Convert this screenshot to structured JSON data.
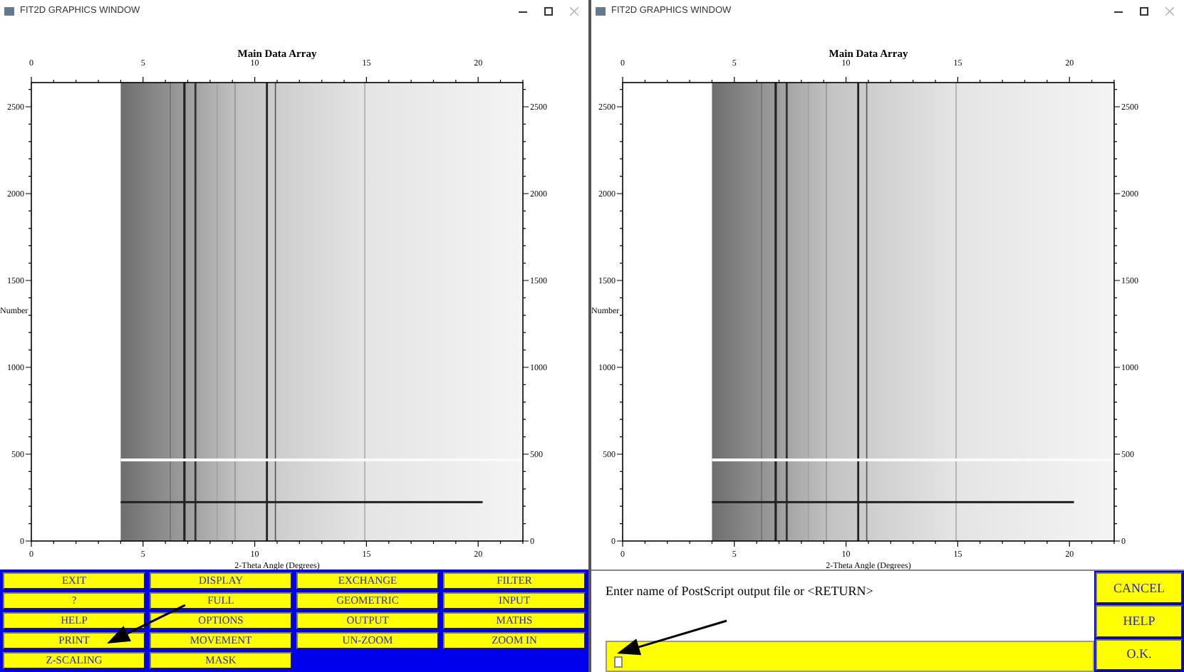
{
  "windows": [
    {
      "title": "FIT2D GRAPHICS WINDOW",
      "plot": {
        "title": "Main Data Array",
        "top_xticks": [
          "0",
          "5",
          "10",
          "15",
          "20"
        ],
        "left_yticks": [
          "2500",
          "2000",
          "1500",
          "1000",
          "500",
          "0"
        ],
        "right_yticks": [
          "2500",
          "2000",
          "1500",
          "1000",
          "500",
          "0"
        ],
        "ylabel": "Number",
        "bottom_xticks": [
          "0",
          "5",
          "10",
          "15",
          "20"
        ],
        "xlabel": "2-Theta Angle (Degrees)"
      },
      "panel": {
        "kind": "menu",
        "buttons": [
          "EXIT",
          "DISPLAY",
          "EXCHANGE",
          "FILTER",
          "?",
          "FULL",
          "GEOMETRIC",
          "INPUT",
          "HELP",
          "OPTIONS",
          "OUTPUT",
          "MATHS",
          "PRINT",
          "MOVEMENT",
          "UN-ZOOM",
          "ZOOM IN",
          "Z-SCALING",
          "MASK"
        ]
      }
    },
    {
      "title": "FIT2D GRAPHICS WINDOW",
      "plot": {
        "title": "Main Data Array",
        "top_xticks": [
          "0",
          "5",
          "10",
          "15",
          "20"
        ],
        "left_yticks": [
          "2500",
          "2000",
          "1500",
          "1000",
          "500",
          "0"
        ],
        "right_yticks": [
          "2500",
          "2000",
          "1500",
          "1000",
          "500",
          "0"
        ],
        "ylabel": "Number",
        "bottom_xticks": [
          "0",
          "5",
          "10",
          "15",
          "20"
        ],
        "xlabel": "2-Theta Angle (Degrees)"
      },
      "panel": {
        "kind": "prompt",
        "prompt": "Enter name of PostScript output file or <RETURN>",
        "buttons": [
          "CANCEL",
          "HELP",
          "O.K."
        ]
      }
    }
  ]
}
